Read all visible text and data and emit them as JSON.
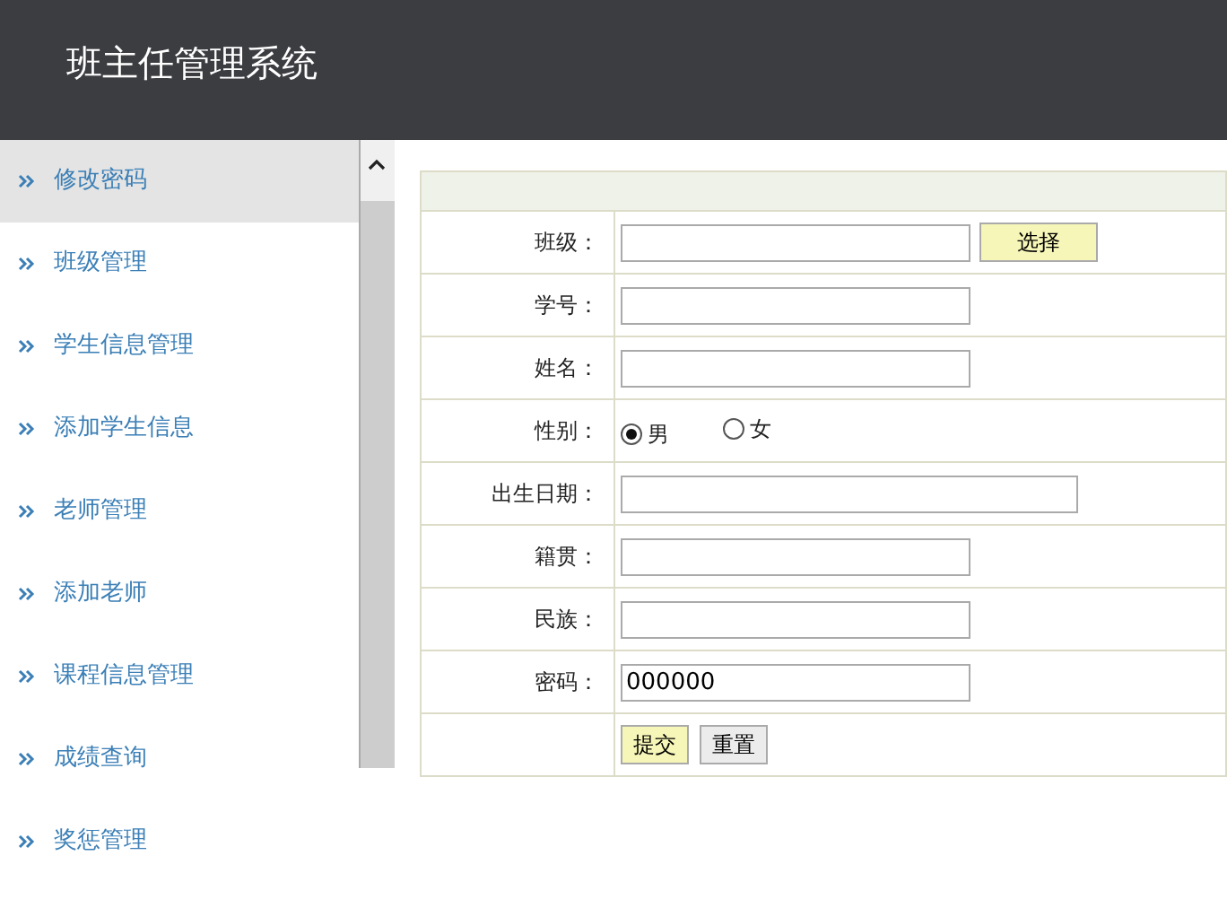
{
  "header": {
    "title": "班主任管理系统"
  },
  "sidebar": {
    "items": [
      {
        "label": "修改密码",
        "selected": true
      },
      {
        "label": "班级管理",
        "selected": false
      },
      {
        "label": "学生信息管理",
        "selected": false
      },
      {
        "label": "添加学生信息",
        "selected": false
      },
      {
        "label": "老师管理",
        "selected": false
      },
      {
        "label": "添加老师",
        "selected": false
      },
      {
        "label": "课程信息管理",
        "selected": false
      },
      {
        "label": "成绩查询",
        "selected": false
      },
      {
        "label": "奖惩管理",
        "selected": false
      }
    ]
  },
  "form": {
    "rows": [
      {
        "kind": "text",
        "label": "班级：",
        "button": "选择"
      },
      {
        "kind": "text",
        "label": "学号："
      },
      {
        "kind": "text",
        "label": "姓名："
      },
      {
        "kind": "radio",
        "label": "性别：",
        "options": [
          {
            "label": "男",
            "selected": true
          },
          {
            "label": "女",
            "selected": false
          }
        ]
      },
      {
        "kind": "text",
        "label": "出生日期：",
        "wide": true
      },
      {
        "kind": "text",
        "label": "籍贯："
      },
      {
        "kind": "text",
        "label": "民族："
      },
      {
        "kind": "text",
        "label": "密码：",
        "value": "000000"
      },
      {
        "kind": "buttons",
        "buttons": [
          {
            "label": "提交",
            "kind": "submit"
          },
          {
            "label": "重置",
            "kind": "reset"
          }
        ]
      }
    ]
  }
}
